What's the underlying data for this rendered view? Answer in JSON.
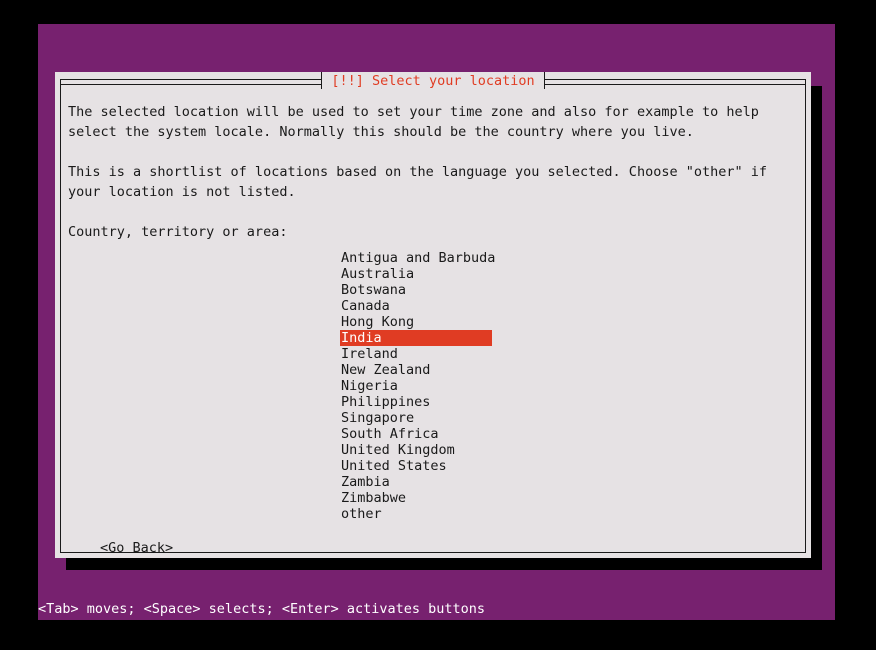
{
  "dialog": {
    "title": "[!!] Select your location",
    "title_color": "#e03c23",
    "background_color": "#e6e2e4",
    "paragraphs": [
      "The selected location will be used to set your time zone and also for example to help",
      "select the system locale. Normally this should be the country where you live.",
      "This is a shortlist of locations based on the language you selected. Choose \"other\" if",
      "your location is not listed."
    ],
    "field_label": "Country, territory or area:",
    "go_back_label": "<Go Back>"
  },
  "country_list": {
    "selected_index": 5,
    "selected_value": "India",
    "highlight_color": "#e03c23",
    "highlight_text_color": "#ffffff",
    "items": [
      "Antigua and Barbuda",
      "Australia",
      "Botswana",
      "Canada",
      "Hong Kong",
      "India",
      "Ireland",
      "New Zealand",
      "Nigeria",
      "Philippines",
      "Singapore",
      "South Africa",
      "United Kingdom",
      "United States",
      "Zambia",
      "Zimbabwe",
      "other"
    ]
  },
  "status_bar": {
    "text": "<Tab> moves; <Space> selects; <Enter> activates buttons",
    "background_color": "#77216f",
    "text_color": "#ffffff"
  },
  "theme": {
    "backdrop_color": "#77216f",
    "screen_color": "#000000",
    "text_color": "#1a1a1a"
  }
}
